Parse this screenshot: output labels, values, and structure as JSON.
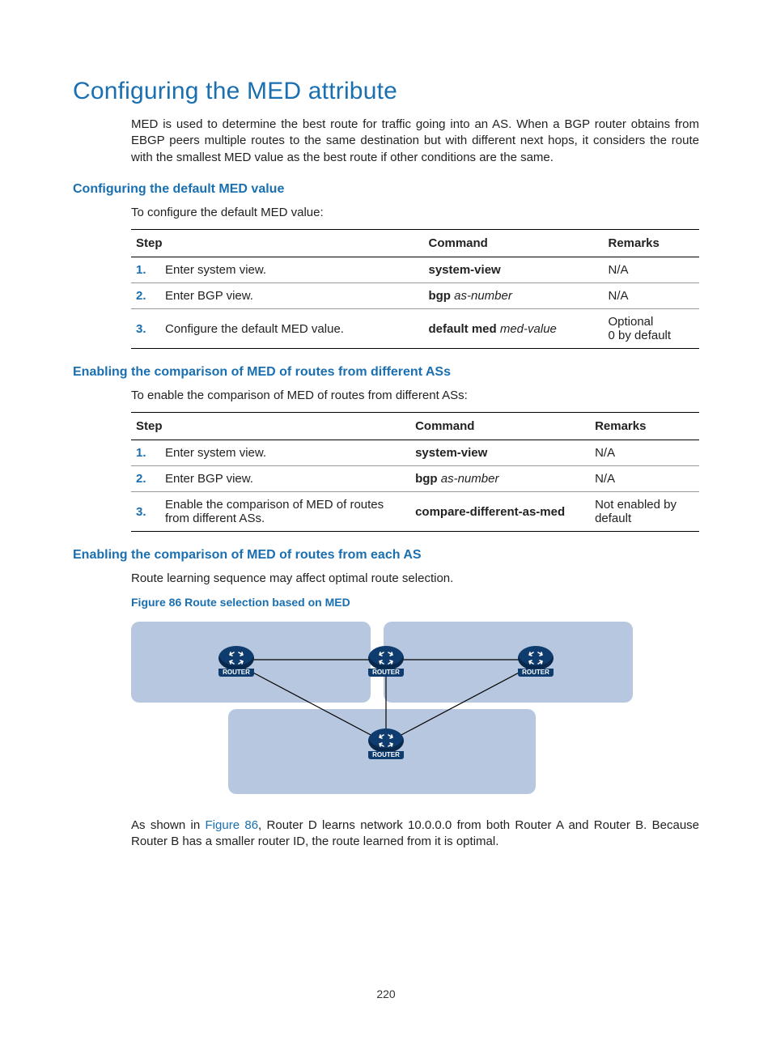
{
  "heading": "Configuring the MED attribute",
  "intro": "MED is used to determine the best route for traffic going into an AS. When a BGP router obtains from EBGP peers multiple routes to the same destination but with different next hops, it considers the route with the smallest MED value as the best route if other conditions are the same.",
  "section1": {
    "title": "Configuring the default MED value",
    "lead": "To configure the default MED value:",
    "table": {
      "headers": {
        "step": "Step",
        "command": "Command",
        "remarks": "Remarks"
      },
      "rows": [
        {
          "num": "1.",
          "step": "Enter system view.",
          "cmd_bold": "system-view",
          "cmd_it": "",
          "remarks": "N/A"
        },
        {
          "num": "2.",
          "step": "Enter BGP view.",
          "cmd_bold": "bgp",
          "cmd_it": " as-number",
          "remarks": "N/A"
        },
        {
          "num": "3.",
          "step": "Configure the default MED value.",
          "cmd_bold": "default med",
          "cmd_it": " med-value",
          "remarks": "Optional\n0 by default"
        }
      ]
    }
  },
  "section2": {
    "title": "Enabling the comparison of MED of routes from different ASs",
    "lead": "To enable the comparison of MED of routes from different ASs:",
    "table": {
      "headers": {
        "step": "Step",
        "command": "Command",
        "remarks": "Remarks"
      },
      "rows": [
        {
          "num": "1.",
          "step": "Enter system view.",
          "cmd_bold": "system-view",
          "cmd_it": "",
          "remarks": "N/A"
        },
        {
          "num": "2.",
          "step": "Enter BGP view.",
          "cmd_bold": "bgp",
          "cmd_it": " as-number",
          "remarks": "N/A"
        },
        {
          "num": "3.",
          "step": "Enable the comparison of MED of routes from different ASs.",
          "cmd_bold": "compare-different-as-med",
          "cmd_it": "",
          "remarks": "Not enabled by default"
        }
      ]
    }
  },
  "section3": {
    "title": "Enabling the comparison of MED of routes from each AS",
    "lead": "Route learning sequence may affect optimal route selection.",
    "figcap": "Figure 86 Route selection based on MED",
    "router_label": "ROUTER",
    "foot_pre": "As shown in ",
    "foot_link": "Figure 86",
    "foot_post": ", Router D learns network 10.0.0.0 from both Router A and Router B. Because Router B has a smaller router ID, the route learned from it is optimal."
  },
  "page_number": "220"
}
